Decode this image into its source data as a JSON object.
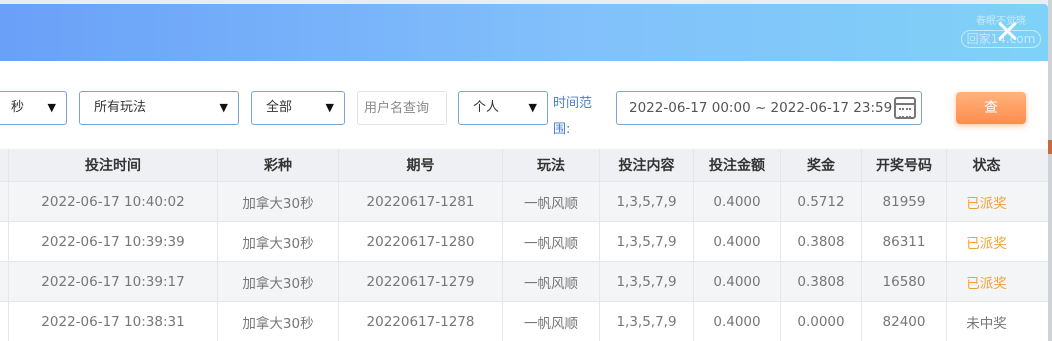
{
  "watermark": {
    "line1": "春眠不觉晓",
    "line2": "回家14.com"
  },
  "filters": {
    "game_time_value": "秒",
    "play_type_value": "所有玩法",
    "scope_value": "全部",
    "username_placeholder": "用户名查询",
    "owner_value": "个人",
    "range_label": "时间范围:",
    "date_range_value": "2022-06-17 00:00 ~ 2022-06-17 23:59",
    "search_label": "查"
  },
  "table": {
    "headers": [
      "投注时间",
      "彩种",
      "期号",
      "玩法",
      "投注内容",
      "投注金额",
      "奖金",
      "开奖号码",
      "状态"
    ],
    "rows": [
      {
        "time": "2022-06-17 10:40:02",
        "lottery": "加拿大30秒",
        "issue": "20220617-1281",
        "play": "一帆风顺",
        "content": "1,3,5,7,9",
        "amount": "0.4000",
        "prize": "0.5712",
        "numbers": "81959",
        "status": "已派奖"
      },
      {
        "time": "2022-06-17 10:39:39",
        "lottery": "加拿大30秒",
        "issue": "20220617-1280",
        "play": "一帆风顺",
        "content": "1,3,5,7,9",
        "amount": "0.4000",
        "prize": "0.3808",
        "numbers": "86311",
        "status": "已派奖"
      },
      {
        "time": "2022-06-17 10:39:17",
        "lottery": "加拿大30秒",
        "issue": "20220617-1279",
        "play": "一帆风顺",
        "content": "1,3,5,7,9",
        "amount": "0.4000",
        "prize": "0.3808",
        "numbers": "16580",
        "status": "已派奖"
      },
      {
        "time": "2022-06-17 10:38:31",
        "lottery": "加拿大30秒",
        "issue": "20220617-1278",
        "play": "一帆风顺",
        "content": "1,3,5,7,9",
        "amount": "0.4000",
        "prize": "0.0000",
        "numbers": "82400",
        "status": "未中奖"
      }
    ]
  },
  "colors": {
    "header_gradient_start": "#6aa0f8",
    "header_gradient_end": "#7fd2f7",
    "accent_blue": "#4a7ec9",
    "status_paid": "#f0a23a",
    "search_button": "#ff8c4f"
  }
}
